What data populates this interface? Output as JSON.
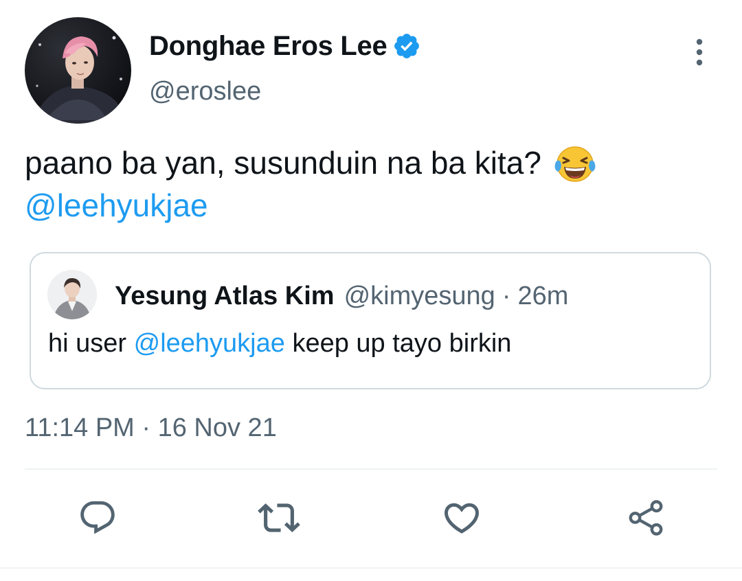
{
  "author": {
    "display_name": "Donghae Eros Lee",
    "handle": "@eroslee",
    "verified": true
  },
  "tweet": {
    "text": "paano ba yan, susunduin na ba kita?",
    "emoji": "face-with-tears-of-joy",
    "mention": "@leehyukjae"
  },
  "quoted_tweet": {
    "display_name": "Yesung Atlas Kim",
    "handle": "@kimyesung",
    "separator": "·",
    "time": "26m",
    "text_before": "hi user ",
    "mention": "@leehyukjae",
    "text_after": " keep up tayo birkin"
  },
  "timestamp": "11:14 PM · 16 Nov 21",
  "icons": {
    "more": "more-vertical-icon",
    "verified": "verified-badge-icon",
    "reply": "reply-icon",
    "retweet": "retweet-icon",
    "like": "like-icon",
    "share": "share-icon"
  },
  "colors": {
    "accent": "#1d9bf0",
    "text": "#0f1419",
    "muted": "#536471",
    "border": "#cfd9de"
  }
}
